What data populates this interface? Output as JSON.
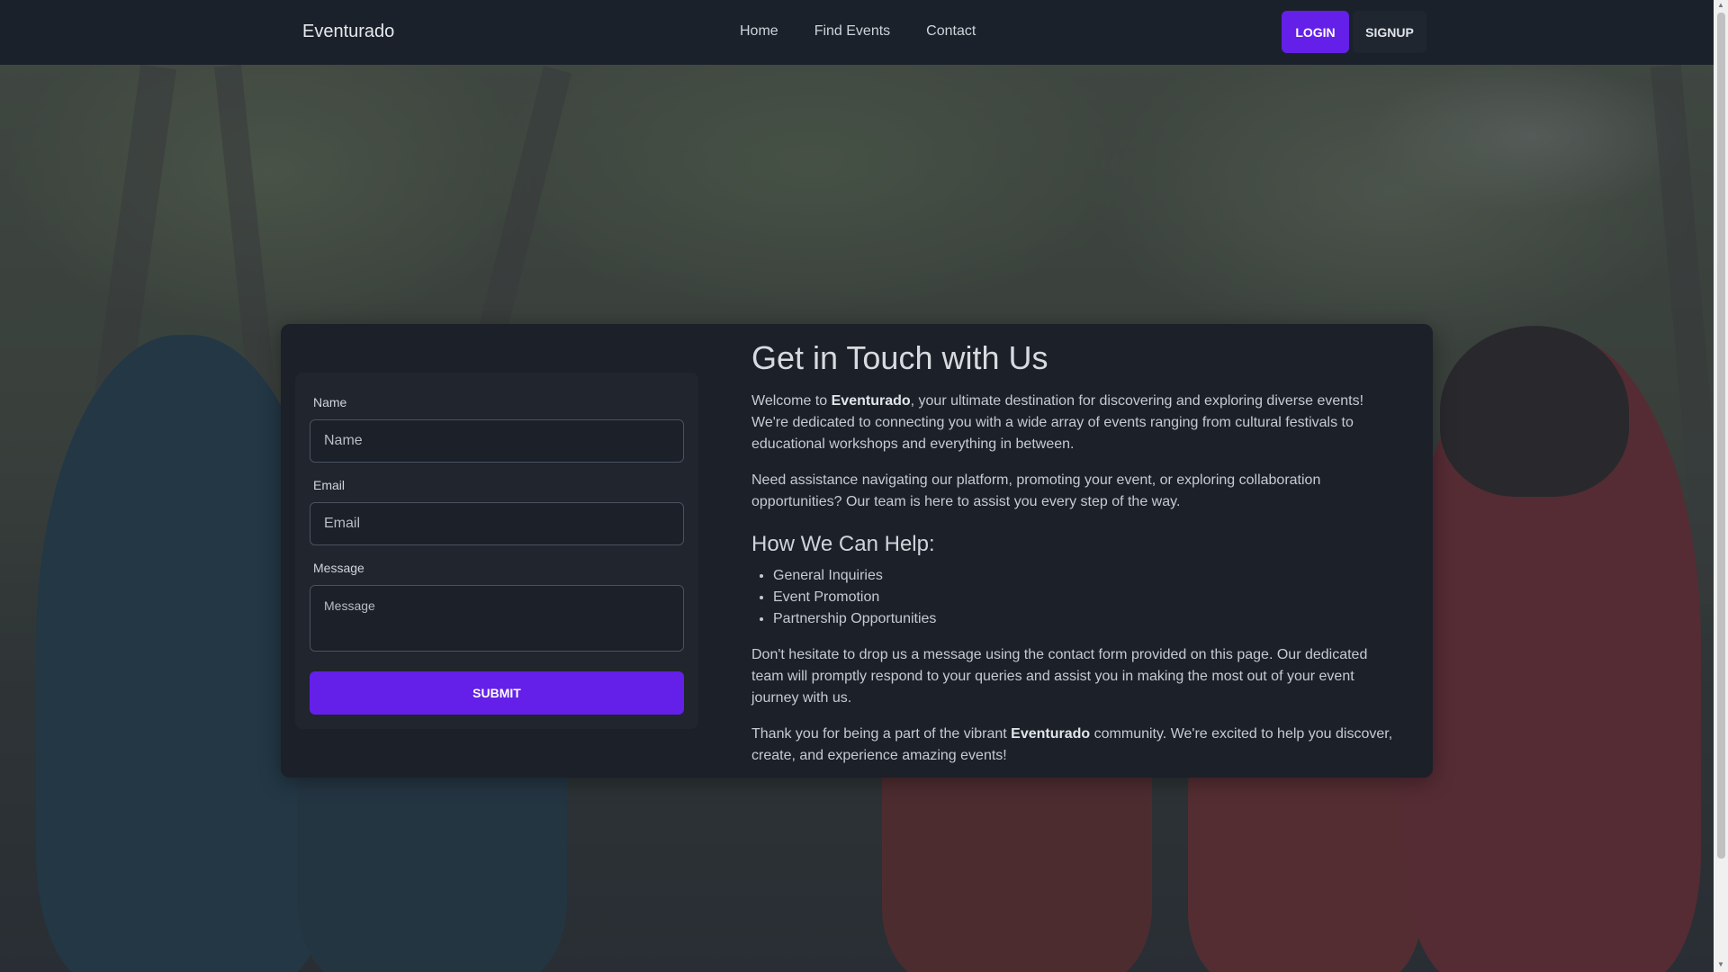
{
  "navbar": {
    "brand": "Eventurado",
    "links": [
      "Home",
      "Find Events",
      "Contact"
    ],
    "login_label": "LOGIN",
    "signup_label": "SIGNUP"
  },
  "form": {
    "name_label": "Name",
    "name_placeholder": "Name",
    "email_label": "Email",
    "email_placeholder": "Email",
    "message_label": "Message",
    "message_placeholder": "Message",
    "submit_label": "SUBMIT"
  },
  "info": {
    "title": "Get in Touch with Us",
    "p1_before": "Welcome to ",
    "p1_brand": "Eventurado",
    "p1_after": ", your ultimate destination for discovering and exploring diverse events! We're dedicated to connecting you with a wide array of events ranging from cultural festivals to educational workshops and everything in between.",
    "p2": "Need assistance navigating our platform, promoting your event, or exploring collaboration opportunities? Our team is here to assist you every step of the way.",
    "help_heading": "How We Can Help:",
    "help_items": [
      "General Inquiries",
      "Event Promotion",
      "Partnership Opportunities"
    ],
    "p3": "Don't hesitate to drop us a message using the contact form provided on this page. Our dedicated team will promptly respond to your queries and assist you in making the most out of your event journey with us.",
    "p4_before": "Thank you for being a part of the vibrant ",
    "p4_brand": "Eventurado",
    "p4_after": " community. We're excited to help you discover, create, and experience amazing events!"
  },
  "colors": {
    "accent": "#6420e8",
    "navbar_bg": "#1b212b",
    "card_bg": "#1c2028"
  },
  "icons": [
    "scroll-up-arrow-icon",
    "scroll-down-arrow-icon"
  ]
}
